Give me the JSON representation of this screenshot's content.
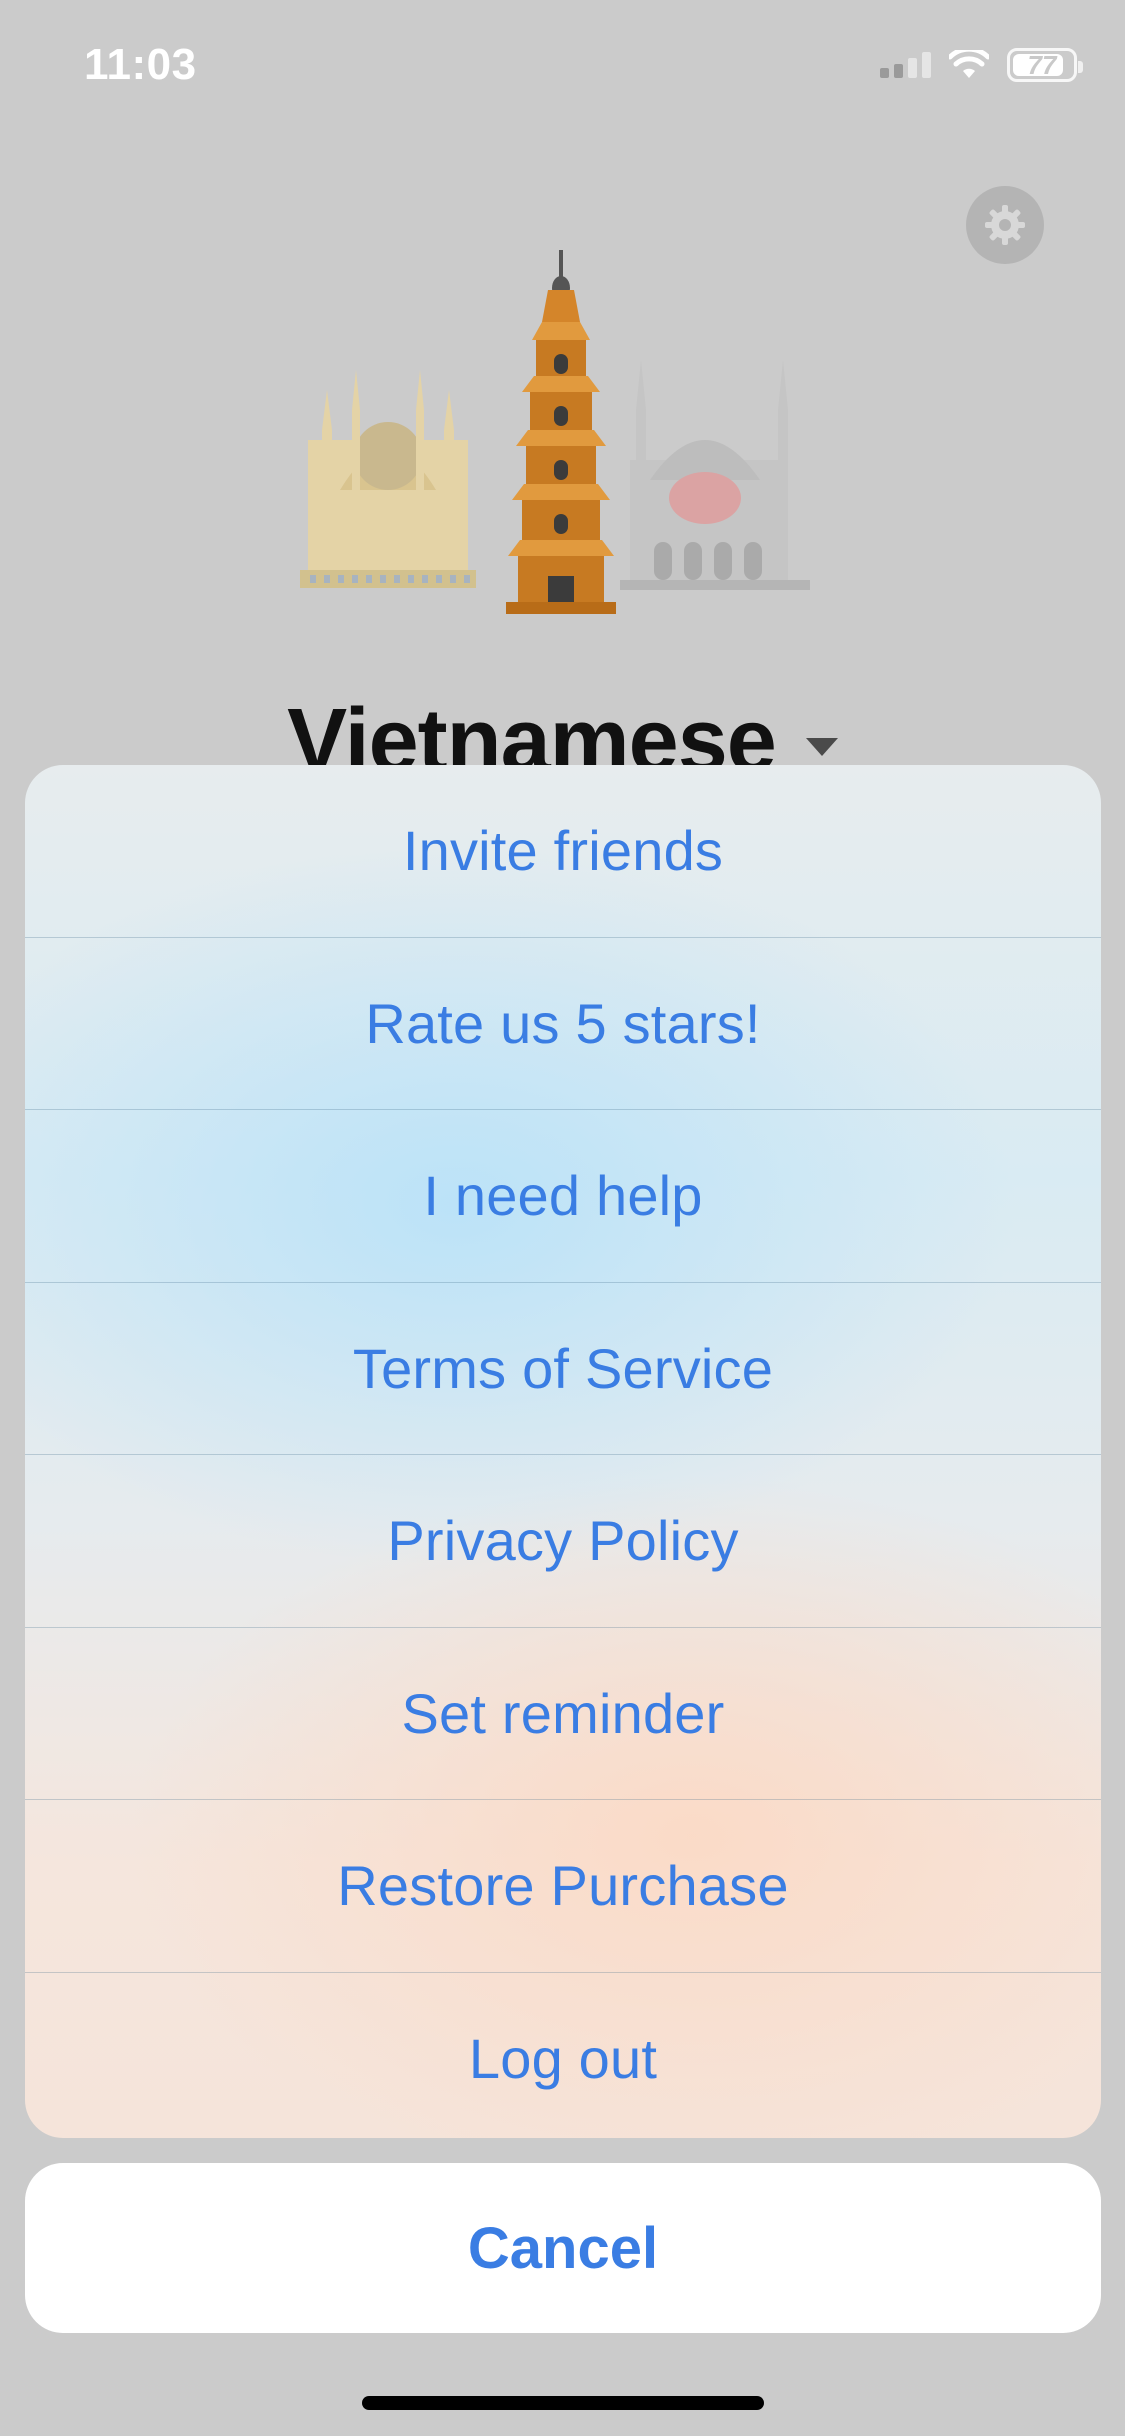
{
  "status_bar": {
    "time": "11:03",
    "battery": "77",
    "battery_level": 0.77
  },
  "header": {
    "settings_icon": "gear-icon",
    "language": "Vietnamese",
    "illustration": "landmarks: mosque, pagoda, cathedral"
  },
  "action_sheet": {
    "items": [
      {
        "label": "Invite friends"
      },
      {
        "label": "Rate us 5 stars!"
      },
      {
        "label": "I need help"
      },
      {
        "label": "Terms of Service"
      },
      {
        "label": "Privacy Policy"
      },
      {
        "label": "Set reminder"
      },
      {
        "label": "Restore Purchase"
      },
      {
        "label": "Log out"
      }
    ],
    "cancel_label": "Cancel"
  },
  "colors": {
    "accent": "#3a7de3",
    "backdrop": "#cbcbcb"
  }
}
